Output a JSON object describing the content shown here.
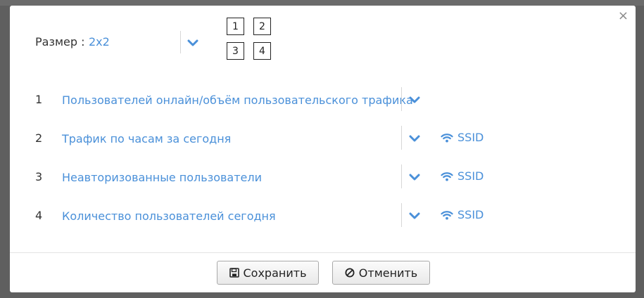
{
  "dialog": {
    "close_symbol": "×",
    "size": {
      "label": "Размер :",
      "value": "2x2"
    },
    "grid_cells": [
      "1",
      "2",
      "3",
      "4"
    ],
    "rows": [
      {
        "num": "1",
        "label": "Пользователей онлайн/объём пользовательского трафика",
        "ssid": ""
      },
      {
        "num": "2",
        "label": "Трафик по часам за сегодня",
        "ssid": "SSID"
      },
      {
        "num": "3",
        "label": "Неавторизованные пользователи",
        "ssid": "SSID"
      },
      {
        "num": "4",
        "label": "Количество пользователей сегодня",
        "ssid": "SSID"
      }
    ],
    "buttons": {
      "save": "Сохранить",
      "cancel": "Отменить"
    }
  },
  "colors": {
    "accent": "#4a90d9",
    "backdrop": "#5f5f5f"
  },
  "icons": {
    "close": "close-icon",
    "dropdown": "chevron-down-icon",
    "wifi": "wifi-icon",
    "save": "save-icon",
    "cancel": "ban-icon"
  }
}
